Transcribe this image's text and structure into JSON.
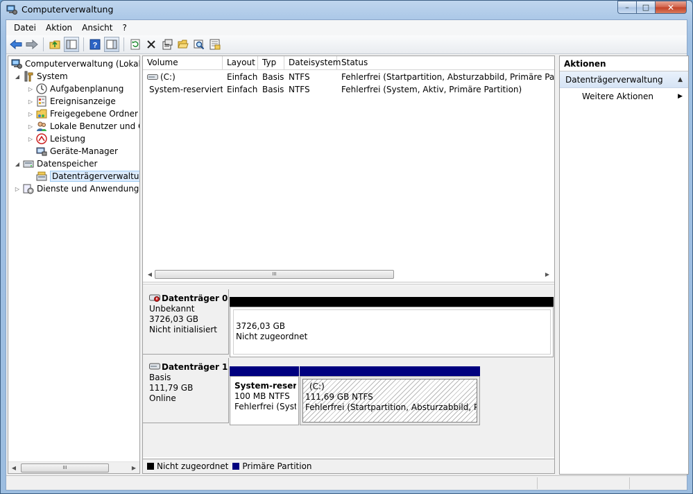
{
  "window": {
    "title": "Computerverwaltung",
    "min": "–",
    "max": "□",
    "close": "✕"
  },
  "menu": [
    "Datei",
    "Aktion",
    "Ansicht",
    "?"
  ],
  "toolbar": [
    "back-arrow-icon",
    "forward-arrow-icon",
    "up-folder-icon",
    "show-hide-tree-icon",
    "help-icon",
    "show-hide-action-pane-icon",
    "refresh-icon",
    "delete-icon",
    "properties-icon",
    "open-folder-icon",
    "search-icon",
    "export-icon"
  ],
  "tree": {
    "root": "Computerverwaltung (Lokal)",
    "system": "System",
    "aufgaben": "Aufgabenplanung",
    "ereignis": "Ereignisanzeige",
    "freigegeben": "Freigegebene Ordner",
    "lokale": "Lokale Benutzer und Gruppen",
    "leistung": "Leistung",
    "geraete": "Geräte-Manager",
    "datenspeicher": "Datenspeicher",
    "datentraeger": "Datenträgerverwaltung",
    "dienste": "Dienste und Anwendungen"
  },
  "volumes": {
    "columns": [
      "Volume",
      "Layout",
      "Typ",
      "Dateisystem",
      "Status"
    ],
    "rows": [
      [
        "(C:)",
        "Einfach",
        "Basis",
        "NTFS",
        "Fehlerfrei (Startpartition, Absturzabbild, Primäre Partition)"
      ],
      [
        "System-reserviert",
        "Einfach",
        "Basis",
        "NTFS",
        "Fehlerfrei (System, Aktiv, Primäre Partition)"
      ]
    ]
  },
  "disks": {
    "d0": {
      "name": "Datenträger 0",
      "type": "Unbekannt",
      "size": "3726,03 GB",
      "state": "Nicht initialisiert",
      "part_size": "3726,03 GB",
      "part_state": "Nicht zugeordnet"
    },
    "d1": {
      "name": "Datenträger 1",
      "type": "Basis",
      "size": "111,79 GB",
      "state": "Online",
      "p1_name": "System-reservi",
      "p1_size": "100 MB NTFS",
      "p1_state": "Fehlerfrei (Syster",
      "p2_name": "(C:)",
      "p2_size": "111,69 GB NTFS",
      "p2_state": "Fehlerfrei (Startpartition, Absturzabbild, Primä"
    }
  },
  "legend": {
    "unallocated": "Nicht zugeordnet",
    "primary": "Primäre Partition"
  },
  "actions": {
    "title": "Aktionen",
    "section": "Datenträgerverwaltung",
    "more": "Weitere Aktionen"
  },
  "scroll": {
    "thumb": "III"
  },
  "colors": {
    "primary": "#00007f",
    "unallocated": "#000000",
    "selection": "#dcebfc"
  }
}
